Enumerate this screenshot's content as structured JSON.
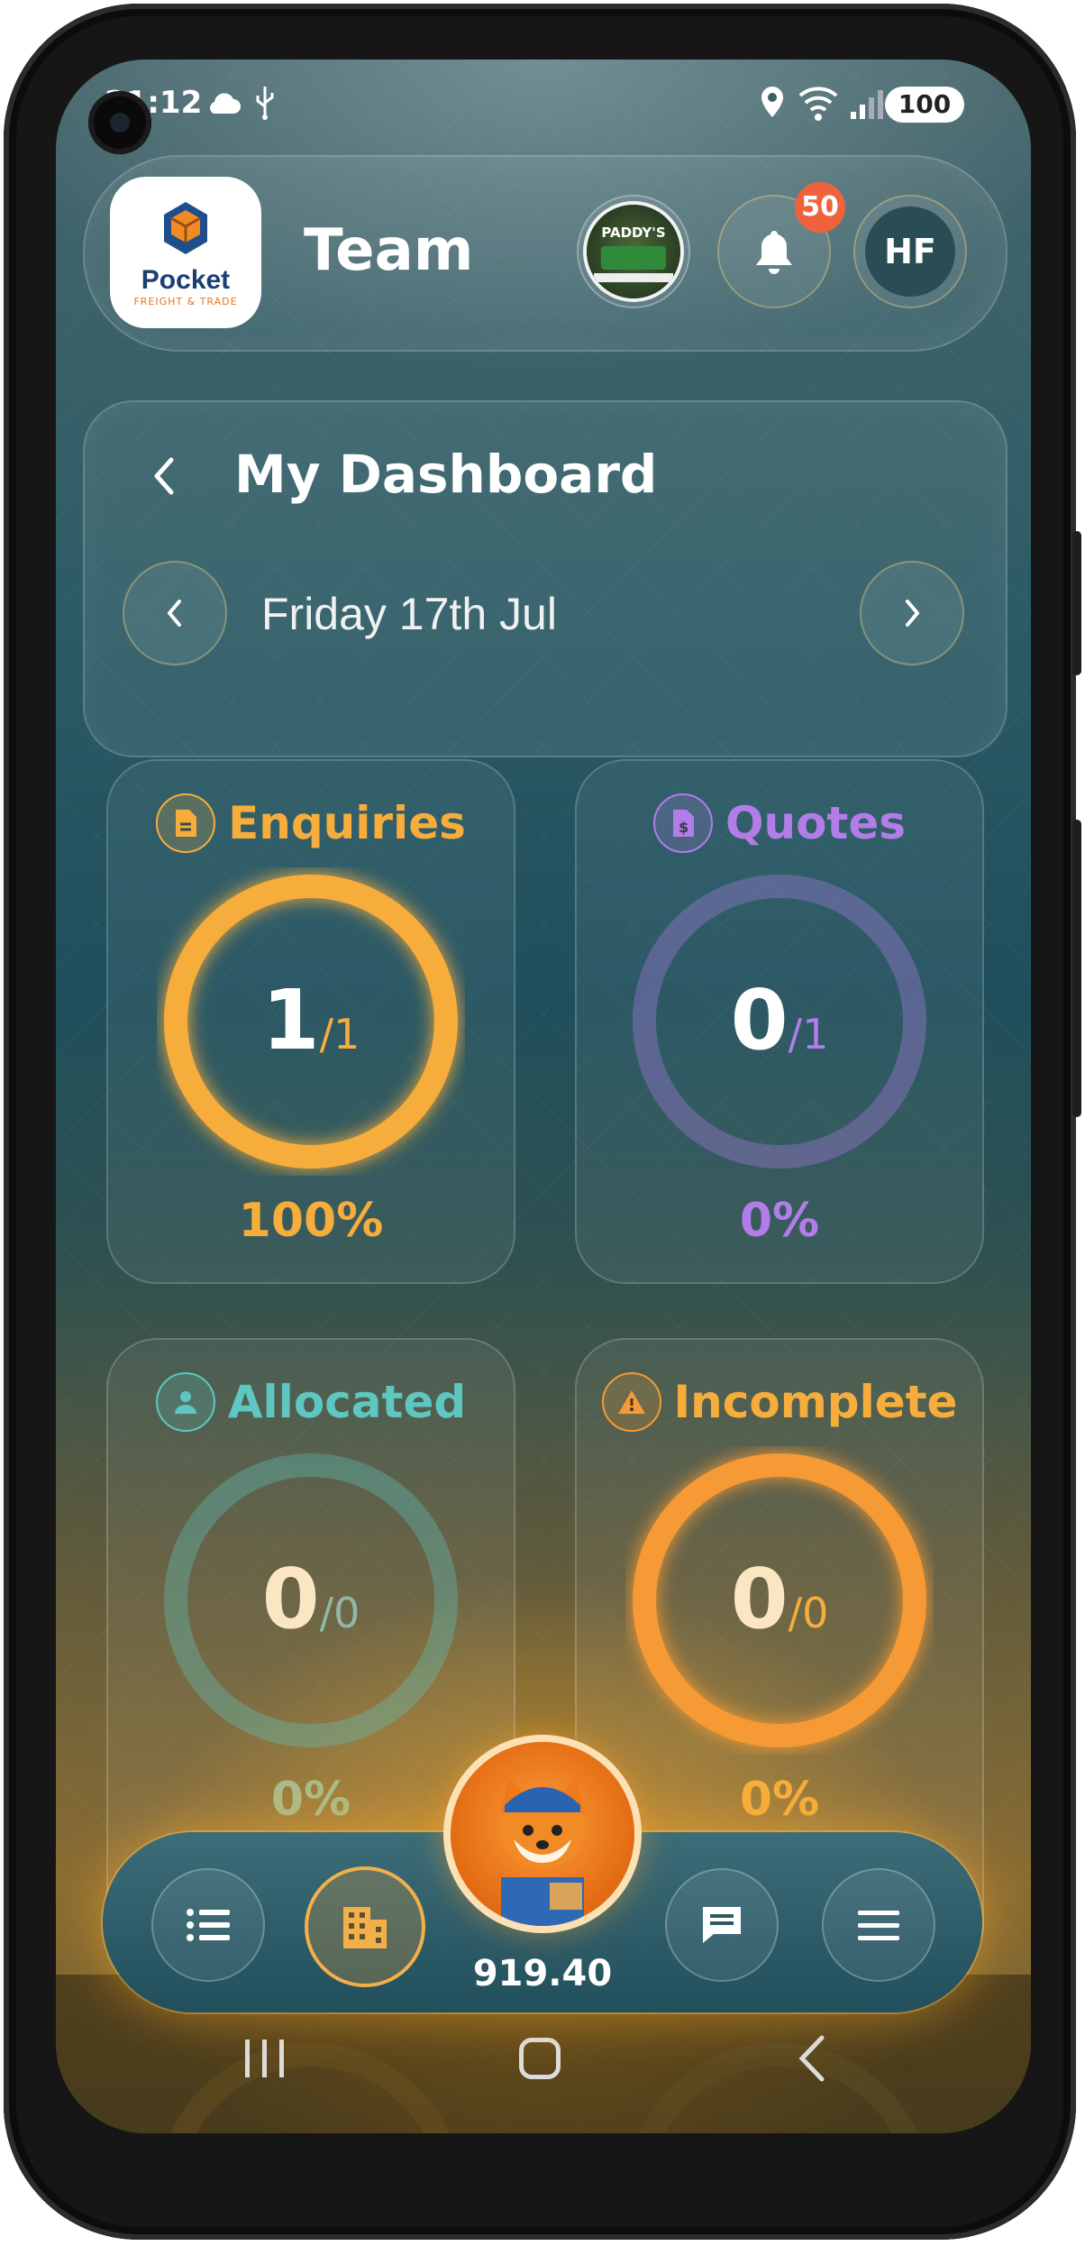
{
  "status_bar": {
    "time": "21:12",
    "battery": "100"
  },
  "header": {
    "team_title": "Team",
    "notifications_count": "50",
    "user_initials": "HF"
  },
  "logo": {
    "text": "Pocket",
    "subtext": "FREIGHT & TRADE"
  },
  "company_badge": {
    "text": "PADDY'S"
  },
  "dashboard": {
    "title": "My Dashboard",
    "date": "Friday 17th Jul"
  },
  "cards": [
    {
      "label": "Enquiries",
      "value": "1",
      "total": "/1",
      "percent": "100%",
      "fraction": 1.0,
      "color": "#f7ad3c"
    },
    {
      "label": "Quotes",
      "value": "0",
      "total": "/1",
      "percent": "0%",
      "fraction": 0,
      "color": "#b27de8"
    },
    {
      "label": "Allocated",
      "value": "0",
      "total": "/0",
      "percent": "0%",
      "fraction": 0,
      "color": "#5fc7c1"
    },
    {
      "label": "Incomplete",
      "value": "0",
      "total": "/0",
      "percent": "0%",
      "fraction": 1.0,
      "color": "#f59a35"
    }
  ],
  "bottom_nav": {
    "balance": "919.40"
  },
  "icons": {
    "back": "chevron-left-icon",
    "prev_date": "chevron-left-icon",
    "next_date": "chevron-right-icon",
    "notifications": "bell-icon",
    "list": "list-icon",
    "building": "building-icon",
    "chat": "chat-icon",
    "menu": "hamburger-icon"
  }
}
